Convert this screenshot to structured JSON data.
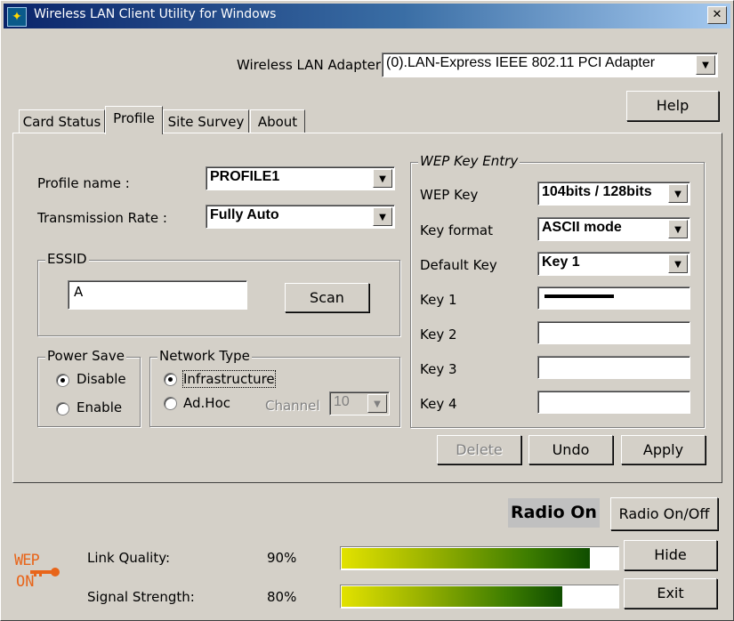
{
  "window": {
    "title": "Wireless LAN Client Utility for Windows",
    "close_label": "✕"
  },
  "adapter": {
    "label": "Wireless LAN Adapter",
    "value": "(0).LAN-Express IEEE 802.11 PCI Adapter"
  },
  "help_label": "Help",
  "tabs": [
    {
      "label": "Card Status"
    },
    {
      "label": "Profile",
      "active": true
    },
    {
      "label": "Site Survey"
    },
    {
      "label": "About"
    }
  ],
  "profile": {
    "name_label": "Profile name :",
    "name_value": "PROFILE1",
    "rate_label": "Transmission Rate :",
    "rate_value": "Fully Auto"
  },
  "essid": {
    "title": "ESSID",
    "value": "A",
    "scan_label": "Scan"
  },
  "power_save": {
    "title": "Power Save",
    "disable_label": "Disable",
    "enable_label": "Enable",
    "selected": "Disable"
  },
  "network_type": {
    "title": "Network Type",
    "infrastructure_label": "Infrastructure",
    "adhoc_label": "Ad.Hoc",
    "channel_label": "Channel",
    "channel_value": "10",
    "selected": "Infrastructure"
  },
  "wep": {
    "title": "WEP Key Entry",
    "wep_key_label": "WEP Key",
    "wep_key_value": "104bits / 128bits",
    "key_format_label": "Key format",
    "key_format_value": "ASCII mode",
    "default_key_label": "Default Key",
    "default_key_value": "Key 1",
    "key1_label": "Key 1",
    "key2_label": "Key 2",
    "key3_label": "Key 3",
    "key4_label": "Key 4"
  },
  "actions": {
    "delete_label": "Delete",
    "undo_label": "Undo",
    "apply_label": "Apply"
  },
  "radio": {
    "status": "Radio On",
    "toggle_label": "Radio On/Off"
  },
  "wep_badge": {
    "line1": "WEP",
    "line2": "ON",
    "color": "#e8651a"
  },
  "link_quality": {
    "label": "Link Quality:",
    "value_text": "90%",
    "fraction": 0.9
  },
  "signal_strength": {
    "label": "Signal Strength:",
    "value_text": "80%",
    "fraction": 0.8
  },
  "hide_label": "Hide",
  "exit_label": "Exit"
}
